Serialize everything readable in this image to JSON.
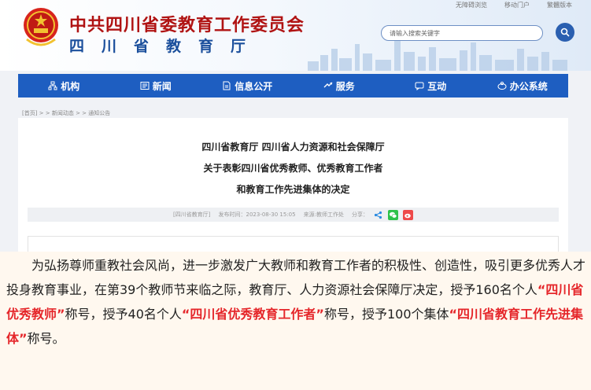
{
  "header": {
    "title": "中共四川省委教育工作委员会",
    "subtitle": "四川省教育厅",
    "top_links": [
      "无障碍浏览",
      "移动门户",
      "繁體版本"
    ],
    "search_placeholder": "请输入搜索关键字",
    "emblem": "national-emblem",
    "search_icon": "search-icon"
  },
  "nav": {
    "items": [
      {
        "label": "机构",
        "icon": "org-icon"
      },
      {
        "label": "新闻",
        "icon": "news-icon"
      },
      {
        "label": "信息公开",
        "icon": "doc-icon"
      },
      {
        "label": "服务",
        "icon": "service-icon"
      },
      {
        "label": "互动",
        "icon": "chat-icon"
      },
      {
        "label": "办公系统",
        "icon": "office-icon"
      }
    ]
  },
  "breadcrumb": "[首页] > > 新闻动态 > > 通知公告",
  "article": {
    "title_lines": [
      "四川省教育厅 四川省人力资源和社会保障厅",
      "关于表彰四川省优秀教师、优秀教育工作者",
      "和教育工作先进集体的决定"
    ],
    "meta_source_tag": "[四川省教育厅]",
    "meta_time": "发布时间：2023-08-30 15:05",
    "meta_origin": "来源:教师工作处",
    "meta_share": "分享："
  },
  "paragraph": {
    "seg1": "为弘扬尊师重教社会风尚，进一步激发广大教师和教育工作者的积极性、创造性，吸引更多优秀人才投身教育事业，在第39个教师节来临之际，教育厅、人力资源社会保障厅决定，授予160名个人",
    "hl1": "“四川省优秀教师”",
    "seg2": "称号，授予40名个人",
    "hl2": "“四川省优秀教育工作者”",
    "seg3": "称号，授予100个集体",
    "hl3": "“四川省教育工作先进集体”",
    "seg4": "称号。"
  },
  "colors": {
    "nav_blue": "#1e5ec1",
    "title_red": "#b01313",
    "highlight_red": "#e5262a",
    "page_bg": "#fff8ef"
  }
}
